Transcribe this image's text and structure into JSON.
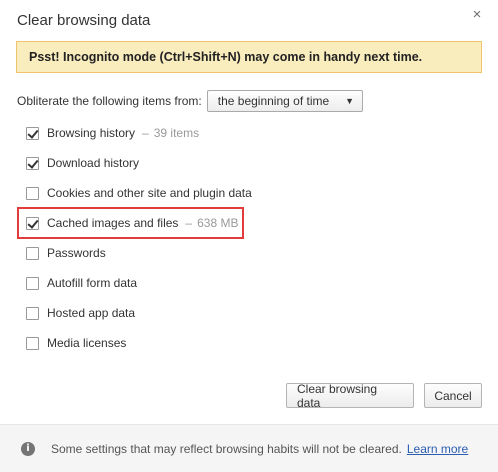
{
  "dialog": {
    "title": "Clear browsing data",
    "close_glyph": "×"
  },
  "banner": {
    "text": "Psst! Incognito mode (Ctrl+Shift+N) may come in handy next time."
  },
  "obliterate": {
    "label": "Obliterate the following items from:",
    "selected": "the beginning of time",
    "arrow_glyph": "▼"
  },
  "items": [
    {
      "label": "Browsing history",
      "separator": "–",
      "meta": "39 items",
      "checked": true
    },
    {
      "label": "Download history",
      "checked": true
    },
    {
      "label": "Cookies and other site and plugin data",
      "checked": false
    },
    {
      "label": "Cached images and files",
      "separator": "–",
      "meta": "638 MB",
      "checked": true,
      "highlighted": true
    },
    {
      "label": "Passwords",
      "checked": false
    },
    {
      "label": "Autofill form data",
      "checked": false
    },
    {
      "label": "Hosted app data",
      "checked": false
    },
    {
      "label": "Media licenses",
      "checked": false
    }
  ],
  "buttons": {
    "clear": "Clear browsing data",
    "cancel": "Cancel"
  },
  "footer": {
    "info_glyph": "i",
    "message": "Some settings that may reflect browsing habits will not be cleared.",
    "link": "Learn more"
  },
  "colors": {
    "banner_bg": "#f9edbe",
    "banner_border": "#f0c36d",
    "highlight": "#e23b3b",
    "link": "#2a5db0"
  }
}
